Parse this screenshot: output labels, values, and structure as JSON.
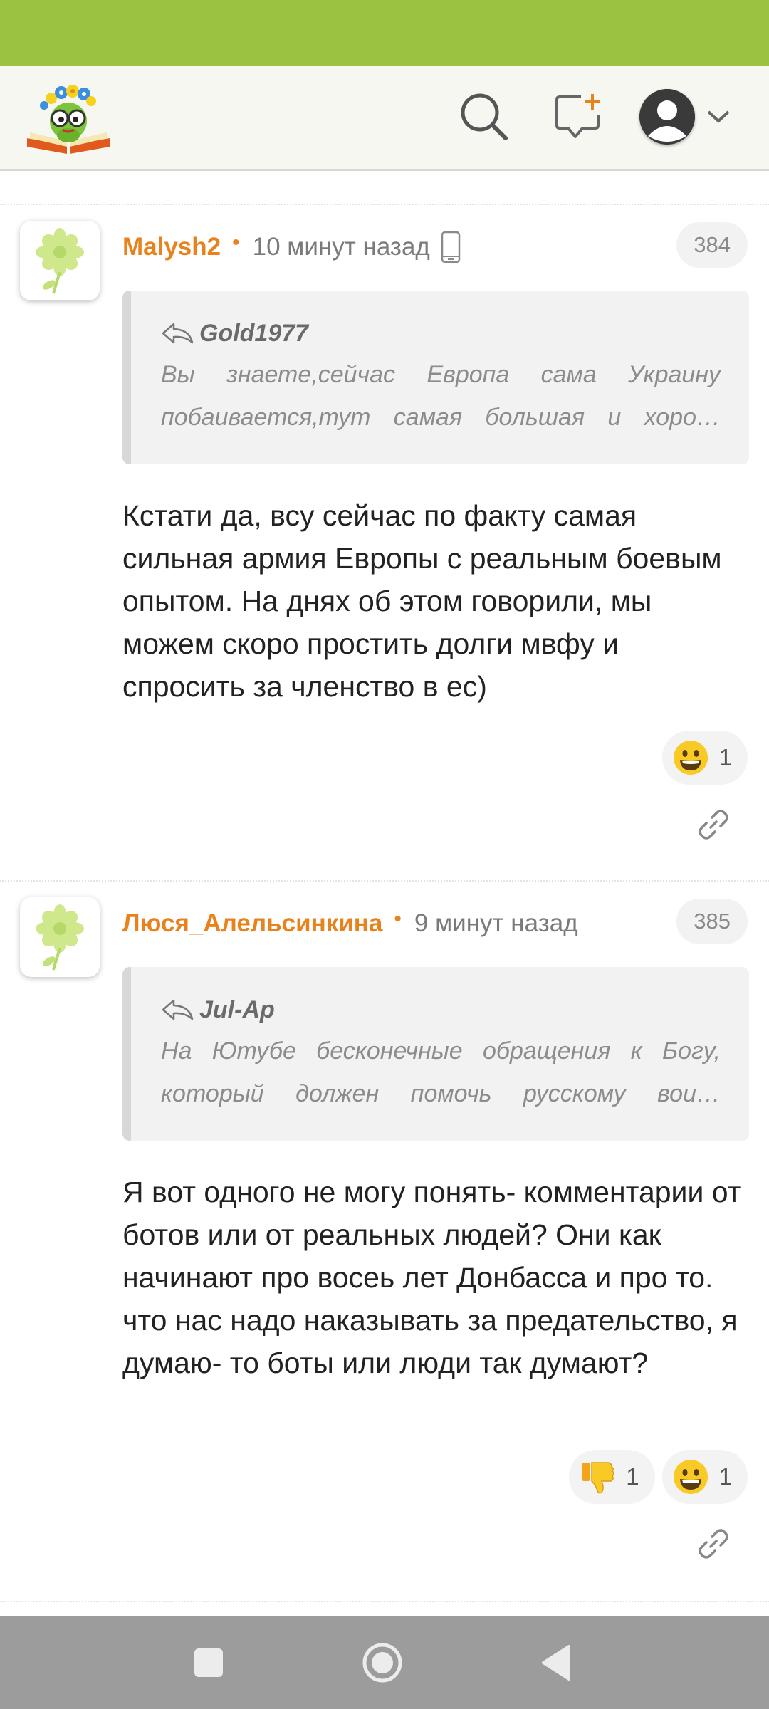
{
  "colors": {
    "status_bar": "#9bc33f",
    "author": "#e8821c",
    "nav_bar": "#9c9c9c"
  },
  "header": {
    "logo_icon": "bookworm-logo",
    "search_icon": "search-icon",
    "new_comment_icon": "new-comment-icon",
    "profile_icon": "user-avatar-icon"
  },
  "comments": [
    {
      "author": "Malysh2",
      "time": "10 минут назад",
      "device_icon": "phone-icon",
      "number": "384",
      "quote": {
        "author": "Gold1977",
        "text": "Вы знаете,сейчас Европа сама Украину побаивается,тут самая большая и хоро…"
      },
      "text": "Кстати да, всу сейчас по факту самая сильная армия Европы с реальным боевым опытом. На днях об этом говорили, мы можем скоро простить долги мвфу и спросить за членство в ес)",
      "reactions": [
        {
          "icon": "grinning-face-emoji",
          "count": "1"
        }
      ]
    },
    {
      "author": "Люся_Алельсинкина",
      "time": "9 минут назад",
      "number": "385",
      "quote": {
        "author": "Jul-Ap",
        "text": "На Ютубе бесконечные обращения к Богу, который должен помочь русскому вои…"
      },
      "text": "Я вот одного не могу понять- комментарии от ботов или от реальных людей? Они как начинают про восеь лет Донбасса и про то. что нас надо наказывать за предательство, я думаю- то боты или люди так думают?",
      "reactions": [
        {
          "icon": "thumbs-down-emoji",
          "count": "1"
        },
        {
          "icon": "grinning-face-emoji",
          "count": "1"
        }
      ]
    }
  ],
  "nav": {
    "recents_icon": "square-icon",
    "home_icon": "circle-icon",
    "back_icon": "triangle-back-icon"
  }
}
